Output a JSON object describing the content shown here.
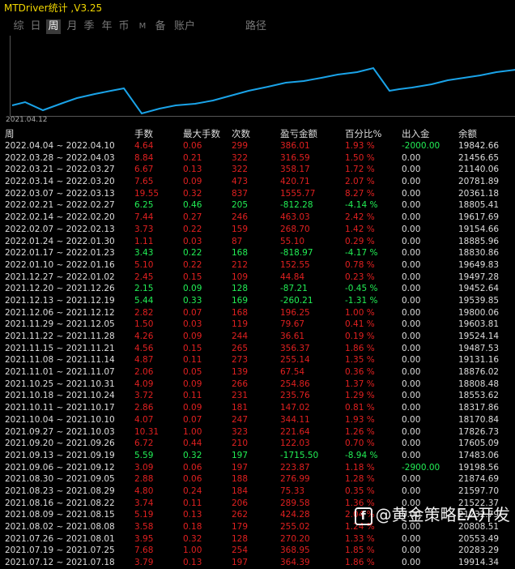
{
  "window": {
    "title": "MTDriver统计 ,V3.25"
  },
  "tabs": [
    {
      "label": "综",
      "active": false,
      "small": false
    },
    {
      "label": "日",
      "active": false,
      "small": false
    },
    {
      "label": "周",
      "active": true,
      "small": false
    },
    {
      "label": "月",
      "active": false,
      "small": false
    },
    {
      "label": "季",
      "active": false,
      "small": false
    },
    {
      "label": "年",
      "active": false,
      "small": false
    },
    {
      "label": "币",
      "active": false,
      "small": false
    },
    {
      "label": "M",
      "active": false,
      "small": true
    },
    {
      "label": "备",
      "active": false,
      "small": false
    },
    {
      "label": "账户",
      "active": false,
      "small": false
    },
    {
      "label": "路径",
      "active": false,
      "small": false
    }
  ],
  "chart": {
    "start_date": "2021.04.12",
    "line_color": "#1aa3e8"
  },
  "table": {
    "headers": [
      "周",
      "手数",
      "最大手数",
      "次数",
      "盈亏金额",
      "百分比%",
      "出入金",
      "余额"
    ],
    "rows": [
      [
        "2022.04.04 ~ 2022.04.10",
        "4.64",
        "0.06",
        "299",
        "386.01",
        "1.93 %",
        "-2000.00",
        "19842.66"
      ],
      [
        "2022.03.28 ~ 2022.04.03",
        "8.84",
        "0.21",
        "322",
        "316.59",
        "1.50 %",
        "0.00",
        "21456.65"
      ],
      [
        "2022.03.21 ~ 2022.03.27",
        "6.67",
        "0.13",
        "322",
        "358.17",
        "1.72 %",
        "0.00",
        "21140.06"
      ],
      [
        "2022.03.14 ~ 2022.03.20",
        "7.65",
        "0.09",
        "473",
        "420.71",
        "2.07 %",
        "0.00",
        "20781.89"
      ],
      [
        "2022.03.07 ~ 2022.03.13",
        "19.55",
        "0.32",
        "837",
        "1555.77",
        "8.27 %",
        "0.00",
        "20361.18"
      ],
      [
        "2022.02.21 ~ 2022.02.27",
        "6.25",
        "0.46",
        "205",
        "-812.28",
        "-4.14 %",
        "0.00",
        "18805.41"
      ],
      [
        "2022.02.14 ~ 2022.02.20",
        "7.44",
        "0.27",
        "246",
        "463.03",
        "2.42 %",
        "0.00",
        "19617.69"
      ],
      [
        "2022.02.07 ~ 2022.02.13",
        "3.73",
        "0.22",
        "159",
        "268.70",
        "1.42 %",
        "0.00",
        "19154.66"
      ],
      [
        "2022.01.24 ~ 2022.01.30",
        "1.11",
        "0.03",
        "87",
        "55.10",
        "0.29 %",
        "0.00",
        "18885.96"
      ],
      [
        "2022.01.17 ~ 2022.01.23",
        "3.43",
        "0.22",
        "168",
        "-818.97",
        "-4.17 %",
        "0.00",
        "18830.86"
      ],
      [
        "2022.01.10 ~ 2022.01.16",
        "5.10",
        "0.22",
        "212",
        "152.55",
        "0.78 %",
        "0.00",
        "19649.83"
      ],
      [
        "2021.12.27 ~ 2022.01.02",
        "2.45",
        "0.15",
        "109",
        "44.84",
        "0.23 %",
        "0.00",
        "19497.28"
      ],
      [
        "2021.12.20 ~ 2021.12.26",
        "2.15",
        "0.09",
        "128",
        "-87.21",
        "-0.45 %",
        "0.00",
        "19452.64"
      ],
      [
        "2021.12.13 ~ 2021.12.19",
        "5.44",
        "0.33",
        "169",
        "-260.21",
        "-1.31 %",
        "0.00",
        "19539.85"
      ],
      [
        "2021.12.06 ~ 2021.12.12",
        "2.82",
        "0.07",
        "168",
        "196.25",
        "1.00 %",
        "0.00",
        "19800.06"
      ],
      [
        "2021.11.29 ~ 2021.12.05",
        "1.50",
        "0.03",
        "119",
        "79.67",
        "0.41 %",
        "0.00",
        "19603.81"
      ],
      [
        "2021.11.22 ~ 2021.11.28",
        "4.26",
        "0.09",
        "244",
        "36.61",
        "0.19 %",
        "0.00",
        "19524.14"
      ],
      [
        "2021.11.15 ~ 2021.11.21",
        "4.56",
        "0.15",
        "265",
        "356.37",
        "1.86 %",
        "0.00",
        "19487.53"
      ],
      [
        "2021.11.08 ~ 2021.11.14",
        "4.87",
        "0.11",
        "273",
        "255.14",
        "1.35 %",
        "0.00",
        "19131.16"
      ],
      [
        "2021.11.01 ~ 2021.11.07",
        "2.06",
        "0.05",
        "139",
        "67.54",
        "0.36 %",
        "0.00",
        "18876.02"
      ],
      [
        "2021.10.25 ~ 2021.10.31",
        "4.09",
        "0.09",
        "266",
        "254.86",
        "1.37 %",
        "0.00",
        "18808.48"
      ],
      [
        "2021.10.18 ~ 2021.10.24",
        "3.72",
        "0.11",
        "231",
        "235.76",
        "1.29 %",
        "0.00",
        "18553.62"
      ],
      [
        "2021.10.11 ~ 2021.10.17",
        "2.86",
        "0.09",
        "181",
        "147.02",
        "0.81 %",
        "0.00",
        "18317.86"
      ],
      [
        "2021.10.04 ~ 2021.10.10",
        "4.07",
        "0.07",
        "247",
        "344.11",
        "1.93 %",
        "0.00",
        "18170.84"
      ],
      [
        "2021.09.27 ~ 2021.10.03",
        "10.31",
        "1.00",
        "323",
        "221.64",
        "1.26 %",
        "0.00",
        "17826.73"
      ],
      [
        "2021.09.20 ~ 2021.09.26",
        "6.72",
        "0.44",
        "210",
        "122.03",
        "0.70 %",
        "0.00",
        "17605.09"
      ],
      [
        "2021.09.13 ~ 2021.09.19",
        "5.59",
        "0.32",
        "197",
        "-1715.50",
        "-8.94 %",
        "0.00",
        "17483.06"
      ],
      [
        "2021.09.06 ~ 2021.09.12",
        "3.09",
        "0.06",
        "197",
        "223.87",
        "1.18 %",
        "-2900.00",
        "19198.56"
      ],
      [
        "2021.08.30 ~ 2021.09.05",
        "2.88",
        "0.06",
        "188",
        "276.99",
        "1.28 %",
        "0.00",
        "21874.69"
      ],
      [
        "2021.08.23 ~ 2021.08.29",
        "4.80",
        "0.24",
        "184",
        "75.33",
        "0.35 %",
        "0.00",
        "21597.70"
      ],
      [
        "2021.08.16 ~ 2021.08.22",
        "3.74",
        "0.11",
        "206",
        "289.58",
        "1.36 %",
        "0.00",
        "21522.37"
      ],
      [
        "2021.08.09 ~ 2021.08.15",
        "5.19",
        "0.13",
        "262",
        "424.28",
        "2.04 %",
        "0.00",
        "21232.79"
      ],
      [
        "2021.08.02 ~ 2021.08.08",
        "3.58",
        "0.18",
        "179",
        "255.02",
        "1.24 %",
        "0.00",
        "20808.51"
      ],
      [
        "2021.07.26 ~ 2021.08.01",
        "3.95",
        "0.32",
        "128",
        "270.20",
        "1.33 %",
        "0.00",
        "20553.49"
      ],
      [
        "2021.07.19 ~ 2021.07.25",
        "7.68",
        "1.00",
        "254",
        "368.95",
        "1.85 %",
        "0.00",
        "20283.29"
      ],
      [
        "2021.07.12 ~ 2021.07.18",
        "3.79",
        "0.13",
        "197",
        "364.39",
        "1.86 %",
        "0.00",
        "19914.34"
      ]
    ]
  },
  "watermark": {
    "text": "@黄金策略EA开发",
    "logo": "f"
  }
}
